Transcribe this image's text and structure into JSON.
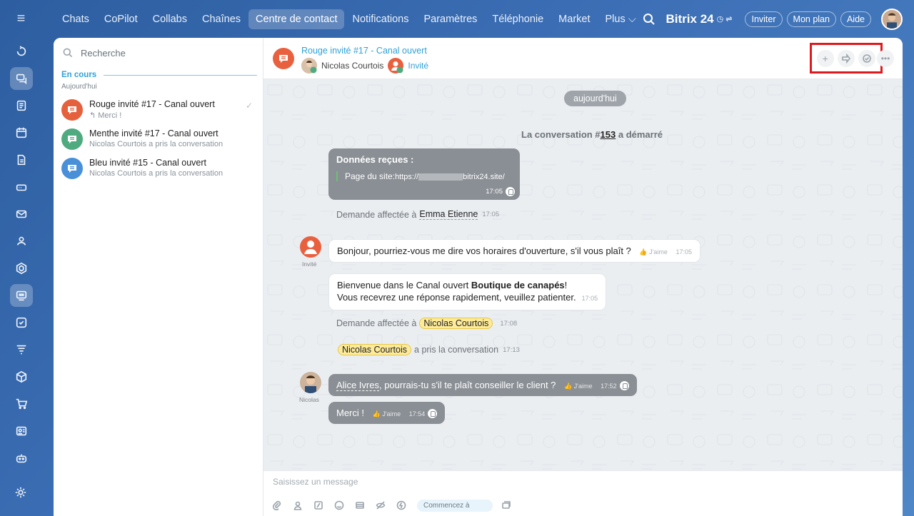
{
  "nav": {
    "tabs": [
      {
        "label": "Chats"
      },
      {
        "label": "CoPilot"
      },
      {
        "label": "Collabs"
      },
      {
        "label": "Chaînes"
      },
      {
        "label": "Centre de contact",
        "active": true
      },
      {
        "label": "Notifications"
      },
      {
        "label": "Paramètres"
      },
      {
        "label": "Téléphonie"
      },
      {
        "label": "Market"
      },
      {
        "label": "Plus ⌵"
      }
    ],
    "brand": "Bitrix 24",
    "invite": "Inviter",
    "plan": "Mon plan",
    "help": "Aide"
  },
  "sidebar": {
    "search_placeholder": "Recherche",
    "section_label": "En cours",
    "day_label": "Aujourd'hui",
    "conversations": [
      {
        "title": "Rouge invité #17 - Canal ouvert",
        "subtitle": "↰ Merci !",
        "color": "#e5603d"
      },
      {
        "title": "Menthe invité #17 - Canal ouvert",
        "subtitle": "Nicolas Courtois a pris la conversation",
        "color": "#4fab7f"
      },
      {
        "title": "Bleu invité #15 - Canal ouvert",
        "subtitle": "Nicolas Courtois a pris la conversation",
        "color": "#4a90d9"
      }
    ]
  },
  "chat": {
    "title": "Rouge invité #17 - Canal ouvert",
    "participant_operator": "Nicolas Courtois",
    "participant_guest": "Invité",
    "date_divider": "aujourd'hui",
    "started_prefix": "La conversation #",
    "started_number": "153",
    "started_suffix": " a démarré",
    "data_card": {
      "heading": "Données reçues :",
      "line_label": "Page du site:",
      "url_start": "https://",
      "url_end": "bitrix24.site/",
      "time": "17:05"
    },
    "sys1": {
      "text": "Demande affectée à",
      "name": "Emma Etienne",
      "time": "17:05"
    },
    "guest_msg": {
      "text": "Bonjour, pourriez-vous me dire vos horaires d'ouverture, s'il vous plaît ?",
      "like": "J'aime",
      "time": "17:05"
    },
    "guest_label": "Invité",
    "bot_msg": {
      "line1_pre": "Bienvenue dans le Canal ouvert ",
      "line1_bold": "Boutique de canapés",
      "line1_post": "!",
      "line2": "Vous recevrez une réponse rapidement, veuillez patienter.",
      "time": "17:05"
    },
    "sys2": {
      "text": "Demande affectée à",
      "name": "Nicolas Courtois",
      "time": "17:08"
    },
    "sys3": {
      "name": "Nicolas Courtois",
      "text": "a pris la conversation",
      "time": "17:13"
    },
    "op_msg1": {
      "mention": "Alice Ivres",
      "text": ", pourrais-tu s'il te plaît conseiller le client ?",
      "like": "J'aime",
      "time": "17:52"
    },
    "op_msg2": {
      "text": "Merci !",
      "like": "J'aime",
      "time": "17:54"
    },
    "op_label": "Nicolas",
    "composer_placeholder": "Saisissez un message",
    "quick_start": "Commencez à"
  }
}
